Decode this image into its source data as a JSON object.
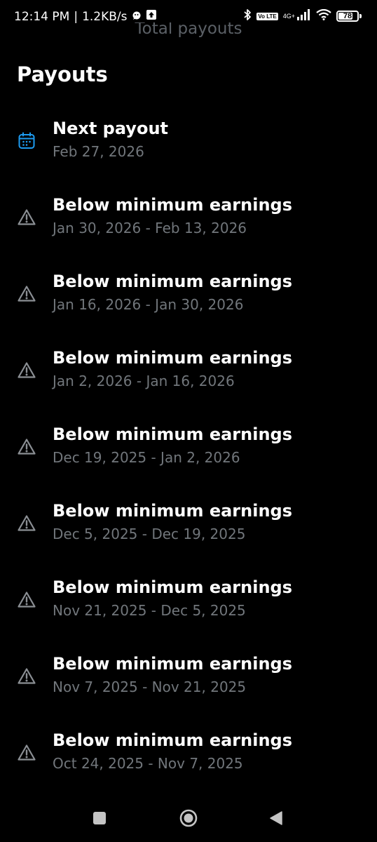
{
  "status_bar": {
    "time": "12:14 PM",
    "speed": "1.2KB/s",
    "network": "4G+",
    "volte": "Vo LTE",
    "battery": "78",
    "battery_level": 0.78
  },
  "header": {
    "faded_title": "Total payouts"
  },
  "section": {
    "title": "Payouts"
  },
  "payouts": [
    {
      "icon": "calendar-icon",
      "title": "Next payout",
      "dates": "Feb 27, 2026"
    },
    {
      "icon": "warning-icon",
      "title": "Below minimum earnings",
      "dates": "Jan 30, 2026 - Feb 13, 2026"
    },
    {
      "icon": "warning-icon",
      "title": "Below minimum earnings",
      "dates": "Jan 16, 2026 - Jan 30, 2026"
    },
    {
      "icon": "warning-icon",
      "title": "Below minimum earnings",
      "dates": "Jan 2, 2026 - Jan 16, 2026"
    },
    {
      "icon": "warning-icon",
      "title": "Below minimum earnings",
      "dates": "Dec 19, 2025 - Jan 2, 2026"
    },
    {
      "icon": "warning-icon",
      "title": "Below minimum earnings",
      "dates": "Dec 5, 2025 - Dec 19, 2025"
    },
    {
      "icon": "warning-icon",
      "title": "Below minimum earnings",
      "dates": "Nov 21, 2025 - Dec 5, 2025"
    },
    {
      "icon": "warning-icon",
      "title": "Below minimum earnings",
      "dates": "Nov 7, 2025 - Nov 21, 2025"
    },
    {
      "icon": "warning-icon",
      "title": "Below minimum earnings",
      "dates": "Oct 24, 2025 - Nov 7, 2025"
    }
  ],
  "nav": {
    "recents": "square-icon",
    "home": "circle-icon",
    "back": "triangle-icon"
  },
  "colors": {
    "background": "#000000",
    "title": "#ffffff",
    "subtitle": "#71767b",
    "calendar_accent": "#1d9bf0",
    "warning": "#8b8f94"
  }
}
